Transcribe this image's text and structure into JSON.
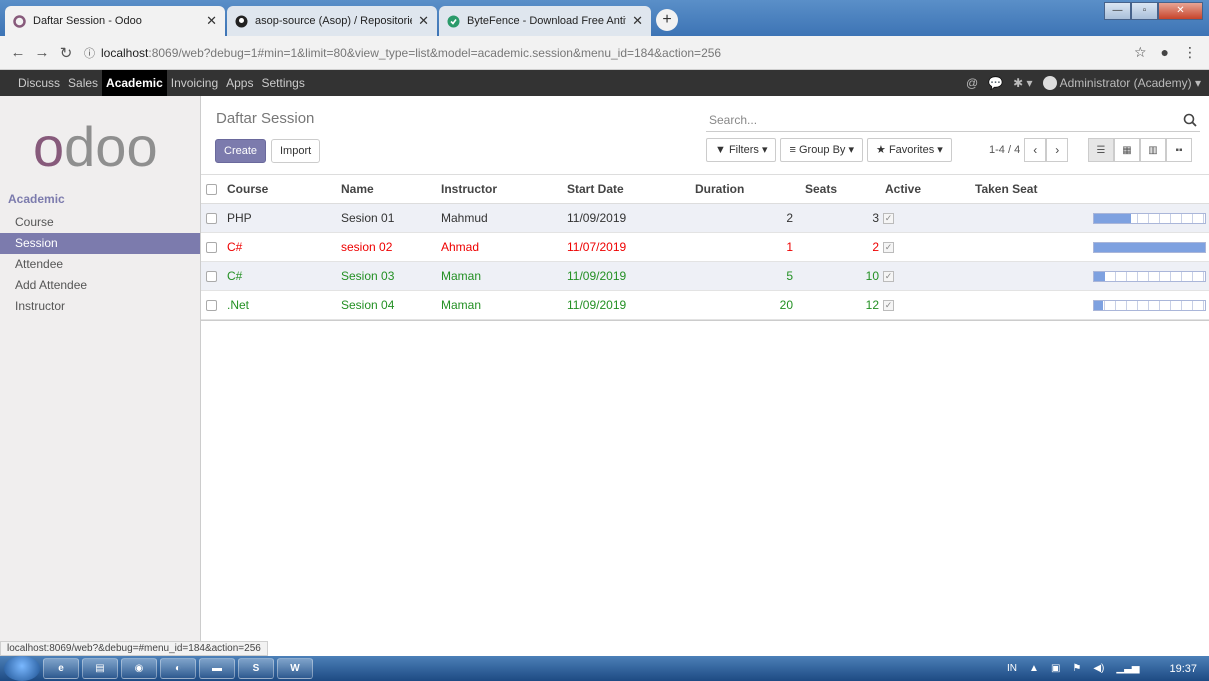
{
  "browser": {
    "tabs": [
      {
        "title": "Daftar Session - Odoo",
        "active": true
      },
      {
        "title": "asop-source (Asop) / Repositorie",
        "active": false
      },
      {
        "title": "ByteFence - Download Free Antiv",
        "active": false
      }
    ],
    "new_tab_label": "+",
    "url_host": "localhost",
    "url_path": ":8069/web?debug=1#min=1&limit=80&view_type=list&model=academic.session&menu_id=184&action=256",
    "status_url": "localhost:8069/web?&debug=#menu_id=184&action=256"
  },
  "main_menu": {
    "items": [
      "Discuss",
      "Sales",
      "Academic",
      "Invoicing",
      "Apps",
      "Settings"
    ],
    "active": "Academic",
    "user": "Administrator (Academy)"
  },
  "logo_text": "odoo",
  "sidebar": {
    "section": "Academic",
    "items": [
      "Course",
      "Session",
      "Attendee",
      "Add Attendee",
      "Instructor"
    ],
    "active": "Session"
  },
  "control_panel": {
    "breadcrumb": "Daftar Session",
    "create_label": "Create",
    "import_label": "Import",
    "search_placeholder": "Search...",
    "filters_label": "Filters",
    "groupby_label": "Group By",
    "favorites_label": "Favorites",
    "pager_value": "1-4 / 4"
  },
  "table": {
    "columns": [
      "Course",
      "Name",
      "Instructor",
      "Start Date",
      "Duration",
      "Seats",
      "Active",
      "Taken Seat"
    ],
    "rows": [
      {
        "course": "PHP",
        "name": "Sesion 01",
        "instructor": "Mahmud",
        "start_date": "11/09/2019",
        "duration": "2",
        "seats": "3",
        "active": true,
        "taken_pct": 33,
        "color": "default"
      },
      {
        "course": "C#",
        "name": "sesion 02",
        "instructor": "Ahmad",
        "start_date": "11/07/2019",
        "duration": "1",
        "seats": "2",
        "active": true,
        "taken_pct": 100,
        "color": "red"
      },
      {
        "course": "C#",
        "name": "Sesion 03",
        "instructor": "Maman",
        "start_date": "11/09/2019",
        "duration": "5",
        "seats": "10",
        "active": true,
        "taken_pct": 10,
        "color": "green"
      },
      {
        "course": ".Net",
        "name": "Sesion 04",
        "instructor": "Maman",
        "start_date": "11/09/2019",
        "duration": "20",
        "seats": "12",
        "active": true,
        "taken_pct": 8,
        "color": "green"
      }
    ]
  },
  "taskbar": {
    "word_label": "W",
    "lang": "IN",
    "clock": "19:37"
  },
  "colors": {
    "brand": "#7c7bad",
    "logo_o": "#875a7b",
    "logo_doo": "#8f8f8f",
    "row_red": "#ee0000",
    "row_green": "#239023"
  }
}
